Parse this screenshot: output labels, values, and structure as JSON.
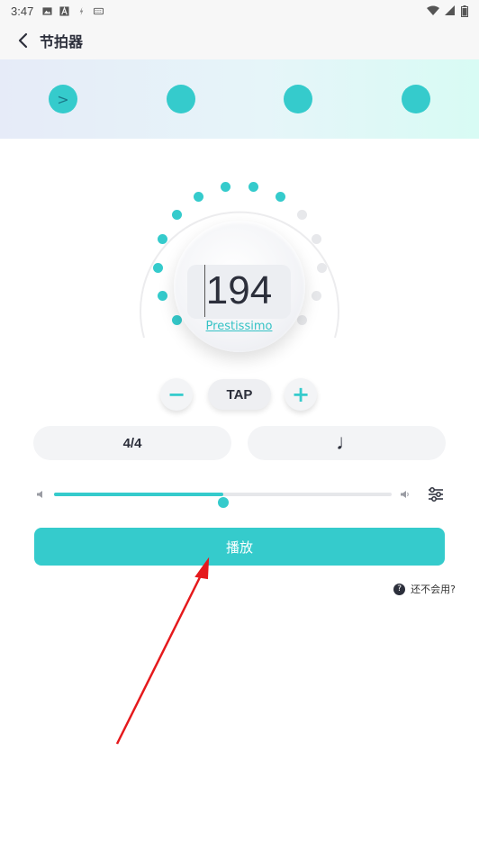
{
  "status_bar": {
    "time": "3:47"
  },
  "app_bar": {
    "title": "节拍器"
  },
  "beat_strip": {
    "beats": [
      {
        "label": ">",
        "active": true
      },
      {
        "label": "",
        "active": false
      },
      {
        "label": "",
        "active": false
      },
      {
        "label": "",
        "active": false
      }
    ]
  },
  "dial": {
    "bpm": "194",
    "tempo_name": "Prestissimo"
  },
  "controls": {
    "minus_label": "−",
    "tap_label": "TAP",
    "plus_label": "+"
  },
  "settings": {
    "time_signature": "4/4",
    "note_value": "♩"
  },
  "volume": {
    "level_fraction": 0.5
  },
  "play_button": {
    "label": "播放"
  },
  "help": {
    "label": "还不会用?",
    "icon_text": "?"
  },
  "colors": {
    "accent": "#35cbcc",
    "arrow": "#e5191c"
  }
}
